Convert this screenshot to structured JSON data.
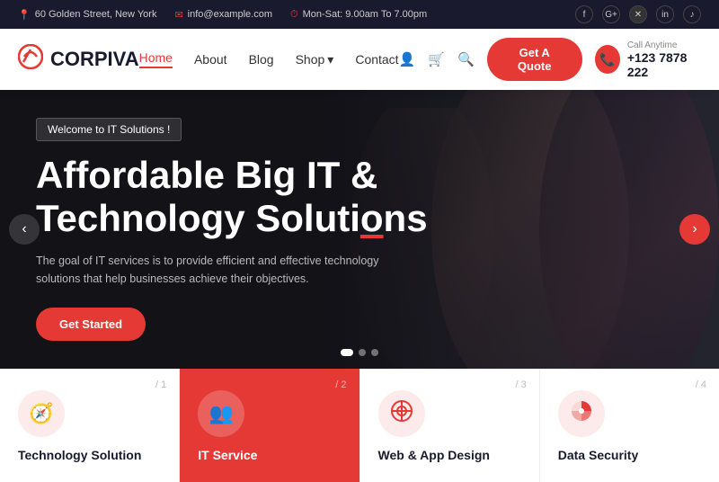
{
  "topbar": {
    "address": "60 Golden Street, New York",
    "email": "info@example.com",
    "hours": "Mon-Sat: 9.00am To 7.00pm",
    "socials": [
      "f",
      "G+",
      "✕",
      "in",
      "♪"
    ]
  },
  "navbar": {
    "logo": "CORPIVA",
    "links": [
      {
        "label": "Home",
        "active": true
      },
      {
        "label": "About",
        "active": false
      },
      {
        "label": "Blog",
        "active": false
      },
      {
        "label": "Shop",
        "has_dropdown": true,
        "active": false
      },
      {
        "label": "Contact",
        "active": false
      }
    ],
    "cta_label": "Get A Quote",
    "call_label": "Call Anytime",
    "call_number": "+123 7878 222"
  },
  "hero": {
    "badge": "Welcome to IT Solutions !",
    "title_line1": "Affordable Big IT &",
    "title_line2": "Technology Soluti",
    "title_underline": "o",
    "title_end": "ns",
    "description": "The goal of IT services is to provide efficient and effective technology solutions that help businesses achieve their objectives.",
    "cta_label": "Get Started",
    "dots": [
      true,
      false,
      false
    ]
  },
  "services": [
    {
      "num": "/ 1",
      "icon": "🧭",
      "name": "Technology Solution",
      "active": false
    },
    {
      "num": "/ 2",
      "icon": "👥",
      "name": "IT Service",
      "active": true
    },
    {
      "num": "/ 3",
      "icon": "⊙",
      "name": "Web & App Design",
      "active": false
    },
    {
      "num": "/ 4",
      "icon": "◑",
      "name": "Data Security",
      "active": false
    }
  ]
}
